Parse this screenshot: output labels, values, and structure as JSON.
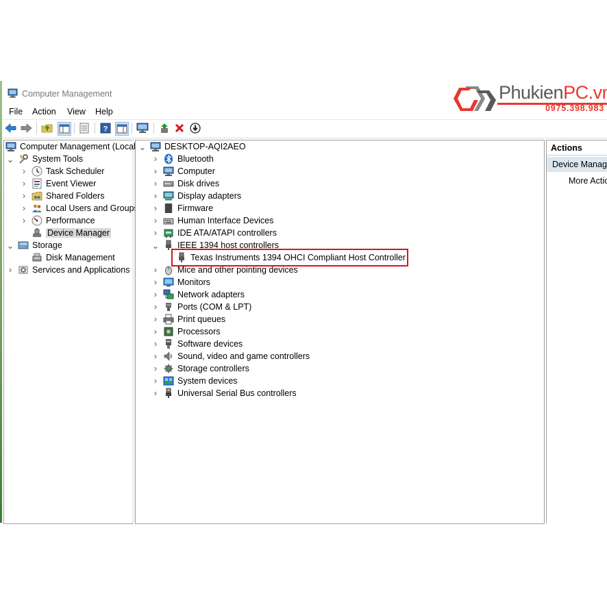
{
  "window": {
    "title": "Computer Management"
  },
  "menu": [
    "File",
    "Action",
    "View",
    "Help"
  ],
  "toolbar": {
    "icons": [
      "back-arrow-icon",
      "forward-arrow-icon",
      "up-folder-icon",
      "show-tree-icon",
      "properties-icon",
      "help-icon",
      "show-action-pane-icon",
      "monitor-icon",
      "update-driver-icon",
      "uninstall-icon",
      "disable-device-icon"
    ]
  },
  "left_tree": {
    "root": "Computer Management (Local",
    "system_tools": "System Tools",
    "task_scheduler": "Task Scheduler",
    "event_viewer": "Event Viewer",
    "shared_folders": "Shared Folders",
    "local_users": "Local Users and Groups",
    "performance": "Performance",
    "device_manager": "Device Manager",
    "storage": "Storage",
    "disk_management": "Disk Management",
    "services": "Services and Applications"
  },
  "device_tree": {
    "computer_name": "DESKTOP-AQI2AEO",
    "categories": [
      "Bluetooth",
      "Computer",
      "Disk drives",
      "Display adapters",
      "Firmware",
      "Human Interface Devices",
      "IDE ATA/ATAPI controllers",
      "IEEE 1394 host controllers",
      "Mice and other pointing devices",
      "Monitors",
      "Network adapters",
      "Ports (COM & LPT)",
      "Print queues",
      "Processors",
      "Software devices",
      "Sound, video and game controllers",
      "Storage controllers",
      "System devices",
      "Universal Serial Bus controllers"
    ],
    "expanded_child": "Texas Instruments 1394 OHCI Compliant Host Controller"
  },
  "actions": {
    "header": "Actions",
    "section": "Device Manage",
    "more": "More Actio"
  },
  "watermark": {
    "brand_part1": "Phukien",
    "brand_part2": "PC.vn",
    "phone": "0975.398.983"
  },
  "colors": {
    "highlight_border": "#d9141b",
    "brand_red": "#e8382e",
    "actions_section_bg": "#dde7f1",
    "selected_bg": "#d9d9d9"
  }
}
